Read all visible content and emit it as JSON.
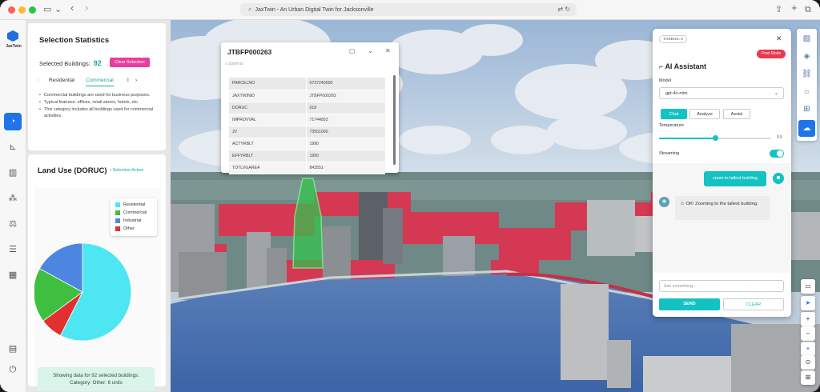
{
  "browser": {
    "url_title": "JaxTwin - An Urban Digital Twin for Jacksonville",
    "traffic_colors": [
      "#ff5f57",
      "#febc2e",
      "#28c840"
    ]
  },
  "app": {
    "logo_text": "JaxTwin"
  },
  "selection": {
    "title": "Selection Statistics",
    "selected_label": "Selected Buildings:",
    "selected_count": "92",
    "clear_label": "Clear Selection",
    "tabs": [
      "Residential",
      "Commercial",
      "I"
    ],
    "active_tab": "Commercial",
    "description": [
      "Commercial buildings are used for business purposes.",
      "Typical features: offices, retail stores, hotels, etc.",
      "This category includes all buildings used for commercial activities."
    ]
  },
  "land_use": {
    "title": "Land Use (DORUC)",
    "subtitle": "• Selection Active",
    "info_line1": "Showing data for 92 selected buildings.",
    "info_line2": "Category: Other: 6 units"
  },
  "chart_data": {
    "type": "pie",
    "categories": [
      "Residential",
      "Commercial",
      "Industrial",
      "Other"
    ],
    "values": [
      54,
      17,
      16,
      7
    ],
    "colors": [
      "#4ee6f3",
      "#3fbf3f",
      "#4d86e0",
      "#e03030"
    ]
  },
  "popup": {
    "title": "JTBFP000263",
    "search_placeholder": "Zoom to",
    "rows": [
      [
        "PARCELNO",
        "0737240000"
      ],
      [
        "JAXTWINID",
        "JTBFP000263"
      ],
      [
        "DORUC",
        "018"
      ],
      [
        "IMPROVVAL",
        "71744893"
      ],
      [
        "JV",
        "73551000"
      ],
      [
        "ACTYRBLT",
        "1990"
      ],
      [
        "EFFYRBLT",
        "1990"
      ],
      [
        "TOTLVGAREA",
        "843551"
      ]
    ]
  },
  "assistant": {
    "tokens": "TOKENS: 0",
    "mode_badge": "Prod Mode",
    "title": "AI Assistant",
    "model_label": "Model",
    "model_value": "gpt-4o-mini",
    "modes": [
      "Chat",
      "Analyze",
      "Assist"
    ],
    "active_mode": "Chat",
    "temperature_label": "Temperature",
    "temperature_value": "0.5",
    "temperature_fraction": 0.5,
    "streaming_label": "Streaming",
    "streaming_on": true,
    "user_message": "zoom to tallest building",
    "bot_message": "OK! Zooming to the tallest building.",
    "input_placeholder": "Ask something...",
    "send_label": "SEND",
    "clear_label": "CLEAR"
  },
  "colors": {
    "accent_teal": "#14c2c2",
    "accent_blue": "#1e74e8",
    "pink": "#e93e9c",
    "highlight_building": "#33c24d"
  }
}
